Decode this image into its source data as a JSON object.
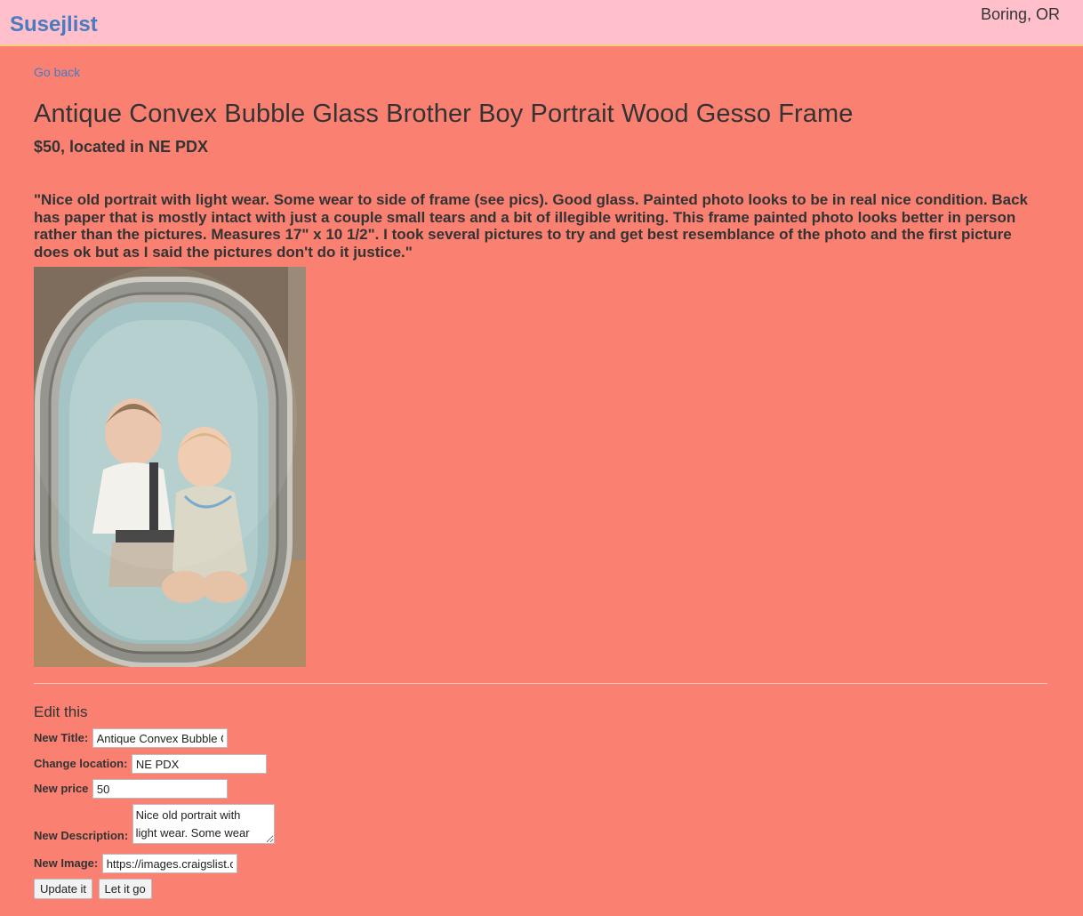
{
  "header": {
    "brand": "Susejlist",
    "location": "Boring, OR"
  },
  "listing": {
    "go_back": "Go back",
    "title": "Antique Convex Bubble Glass Brother Boy Portrait Wood Gesso Frame",
    "price_location": "$50, located in NE PDX",
    "description": "\"Nice old portrait with light wear. Some wear to side of frame (see pics). Good glass. Painted photo looks to be in real nice condition. Back has paper that is mostly intact with just a couple small tears and a bit of illegible writing. This frame painted photo looks better in person rather than the pictures. Measures 17\" x 10 1/2\". I took several pictures to try and get best resemblance of the photo and the first picture does ok but as I said the pictures don't do it justice.\""
  },
  "edit": {
    "heading": "Edit this",
    "title_label": "New Title:",
    "title_value": "Antique Convex Bubble Glass Brother Boy Portrait Wood Gesso Frame",
    "location_label": "Change location:",
    "location_value": "NE PDX",
    "price_label": "New price",
    "price_value": "50",
    "description_label": "New Description:",
    "description_value": "Nice old portrait with light wear. Some wear to side of frame (see pics).",
    "image_label": "New Image:",
    "image_value": "https://images.craigslist.org",
    "update_button": "Update it",
    "delete_button": "Let it go"
  },
  "colors": {
    "background": "#fa8072",
    "header_background": "#ffc0cb",
    "link": "#4a7bc0"
  }
}
